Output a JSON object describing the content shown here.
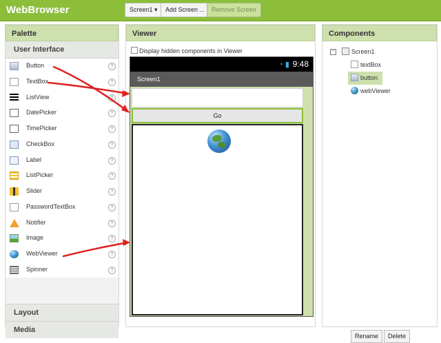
{
  "app": {
    "title": "WebBrowser"
  },
  "toolbar": {
    "screen_dropdown": "Screen1 ▾",
    "add_screen": "Add Screen ...",
    "remove_screen": "Remove Screen"
  },
  "palette": {
    "header": "Palette",
    "section": "User Interface",
    "items": [
      {
        "label": "Button",
        "icon": "button-icon"
      },
      {
        "label": "TextBox",
        "icon": "textbox-icon"
      },
      {
        "label": "ListView",
        "icon": "listview-icon"
      },
      {
        "label": "DatePicker",
        "icon": "datepicker-icon"
      },
      {
        "label": "TimePicker",
        "icon": "timepicker-icon"
      },
      {
        "label": "CheckBox",
        "icon": "checkbox-icon"
      },
      {
        "label": "Label",
        "icon": "label-icon"
      },
      {
        "label": "ListPicker",
        "icon": "listpicker-icon"
      },
      {
        "label": "Slider",
        "icon": "slider-icon"
      },
      {
        "label": "PasswordTextBox",
        "icon": "passwordtextbox-icon"
      },
      {
        "label": "Notifier",
        "icon": "notifier-icon"
      },
      {
        "label": "Image",
        "icon": "image-icon"
      },
      {
        "label": "WebViewer",
        "icon": "webviewer-icon"
      },
      {
        "label": "Spinner",
        "icon": "spinner-icon"
      }
    ],
    "help_glyph": "?",
    "sections_below": [
      "Layout",
      "Media"
    ]
  },
  "viewer": {
    "header": "Viewer",
    "checkbox_label": "Display hidden components in Viewer",
    "status_time": "9:48",
    "screen_title": "Screen1",
    "go_button": "Go"
  },
  "components": {
    "header": "Components",
    "root": "Screen1",
    "collapse_glyph": "−",
    "children": [
      "textBox",
      "button",
      "webViewer"
    ],
    "selected": "button",
    "rename": "Rename",
    "delete": "Delete"
  },
  "colors": {
    "brand_green": "#8cbe3a",
    "header_green": "#cde0ad",
    "annotation_red": "#e02020"
  }
}
